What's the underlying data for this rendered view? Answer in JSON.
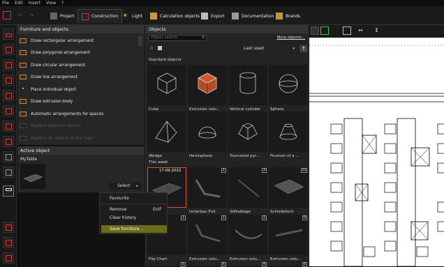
{
  "menu": [
    "File",
    "Edit",
    "Insert",
    "View",
    "?"
  ],
  "toolbar": {
    "tabs": [
      {
        "label": "Project",
        "icon": "project-icon"
      },
      {
        "label": "Construction",
        "icon": "construction-icon"
      },
      {
        "label": "Light",
        "icon": "light-icon"
      },
      {
        "label": "Calculation objects",
        "icon": "calculation-icon"
      },
      {
        "label": "Export",
        "icon": "export-icon"
      },
      {
        "label": "Documentation",
        "icon": "documentation-icon"
      },
      {
        "label": "Brands",
        "icon": "brands-icon"
      }
    ],
    "active_tab": "Construction"
  },
  "furniture_panel": {
    "title": "Furniture and objects",
    "items": [
      {
        "label": "Draw rectangular arrangement",
        "enabled": true
      },
      {
        "label": "Draw polygonal arrangement",
        "enabled": true
      },
      {
        "label": "Draw circular arrangement",
        "enabled": true
      },
      {
        "label": "Draw line arrangement",
        "enabled": true
      },
      {
        "label": "Place individual object",
        "enabled": true
      },
      {
        "label": "Draw extrusion body",
        "enabled": true
      },
      {
        "label": "Automatic arrangements for spaces",
        "enabled": true
      },
      {
        "label": "Replace selected objects",
        "enabled": false
      },
      {
        "label": "Replace all objects of this type",
        "enabled": false
      }
    ]
  },
  "active_object": {
    "title": "Active object",
    "name": "MyTable",
    "select_label": "Select"
  },
  "objects_panel": {
    "title": "Objects",
    "search_placeholder": "Object search",
    "more_link": "More objects...",
    "sort": "Last used",
    "standard_heading": "Standard objects",
    "standard": [
      {
        "label": "Cube",
        "icon": "cube-icon"
      },
      {
        "label": "Extrusion volu...",
        "icon": "extrusion-icon"
      },
      {
        "label": "Vertical cylinder",
        "icon": "cylinder-icon"
      },
      {
        "label": "Sphere",
        "icon": "sphere-icon"
      },
      {
        "label": "Wedge",
        "icon": "wedge-icon"
      },
      {
        "label": "Hemisphere",
        "icon": "hemisphere-icon"
      },
      {
        "label": "Truncated pyr...",
        "icon": "truncated-pyramid-icon"
      },
      {
        "label": "Frustum of a ...",
        "icon": "frustum-icon"
      }
    ],
    "week_heading": "This week",
    "week": [
      {
        "label": "",
        "date": "17.09.2022",
        "count": "",
        "selected": true
      },
      {
        "label": "Unterbau Pult",
        "count": "1"
      },
      {
        "label": "Stiftablage",
        "count": "2"
      },
      {
        "label": "Schreibtisch",
        "count": "12"
      }
    ],
    "older": [
      {
        "label": "Flip Chart",
        "count": "1"
      },
      {
        "label": "Extrusion volu...",
        "count": "1"
      },
      {
        "label": "Extrusion volu...",
        "count": "1"
      },
      {
        "label": "Extrusion volu...",
        "count": "0"
      }
    ],
    "bottom_counts": [
      "5",
      "6",
      "4",
      "6"
    ]
  },
  "context_menu": {
    "items": [
      {
        "label": "Favourite",
        "shortcut": ""
      },
      {
        "label": "Remove",
        "shortcut": "Entf"
      },
      {
        "label": "Clear history",
        "shortcut": ""
      },
      {
        "label": "Save furniture...",
        "shortcut": "",
        "highlighted": true
      }
    ]
  }
}
